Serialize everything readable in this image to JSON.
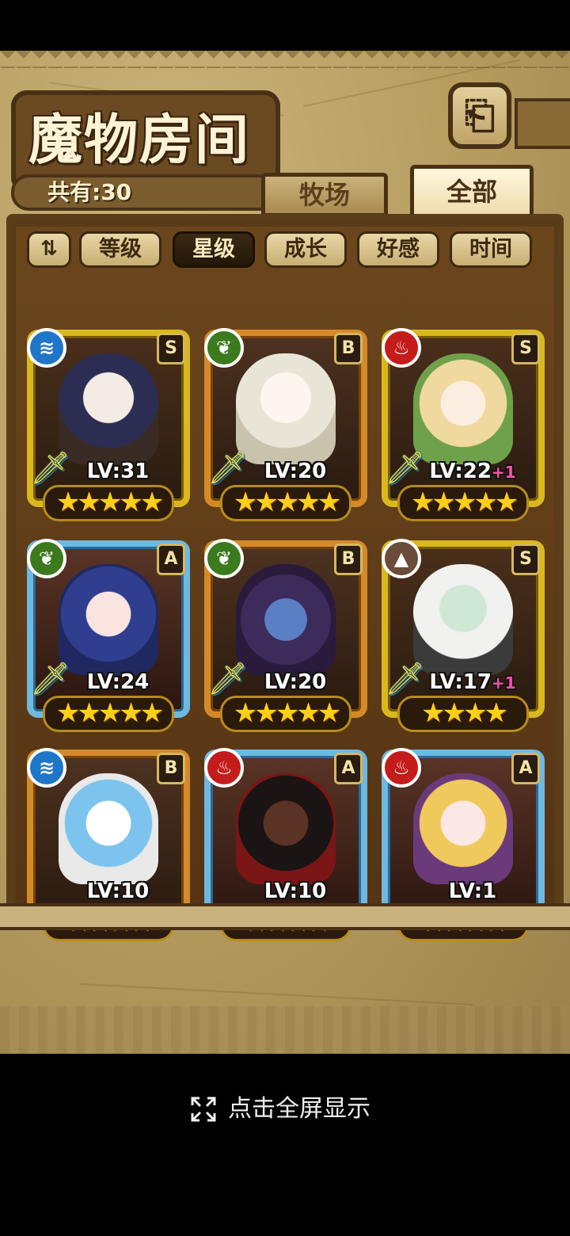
{
  "header": {
    "title": "魔物房间",
    "back_icon": "⎗"
  },
  "summary": {
    "count_label": "共有:30"
  },
  "tabs": [
    {
      "label": "牧场",
      "active": false
    },
    {
      "label": "全部",
      "active": true
    }
  ],
  "sort_toggle": {
    "label": "⇅"
  },
  "filters": [
    {
      "label": "等级",
      "active": false
    },
    {
      "label": "星级",
      "active": true
    },
    {
      "label": "成长",
      "active": false
    },
    {
      "label": "好感",
      "active": false
    },
    {
      "label": "时间",
      "active": false
    }
  ],
  "monsters": [
    {
      "element": "water",
      "element_icon": "≋",
      "rank": "S",
      "level": "LV:31",
      "plus": "",
      "stars": "★★★★★",
      "frame": "gold"
    },
    {
      "element": "grass",
      "element_icon": "❦",
      "rank": "B",
      "level": "LV:20",
      "plus": "",
      "stars": "★★★★★",
      "frame": "bronze"
    },
    {
      "element": "fire",
      "element_icon": "♨",
      "rank": "S",
      "level": "LV:22",
      "plus": "+1",
      "stars": "★★★★★",
      "frame": "gold"
    },
    {
      "element": "grass",
      "element_icon": "❦",
      "rank": "A",
      "level": "LV:24",
      "plus": "",
      "stars": "★★★★★",
      "frame": "blue"
    },
    {
      "element": "grass",
      "element_icon": "❦",
      "rank": "B",
      "level": "LV:20",
      "plus": "",
      "stars": "★★★★★",
      "frame": "bronze"
    },
    {
      "element": "earth",
      "element_icon": "▲",
      "rank": "S",
      "level": "LV:17",
      "plus": "+1",
      "stars": "★★★★",
      "frame": "gold"
    },
    {
      "element": "water",
      "element_icon": "≋",
      "rank": "B",
      "level": "LV:10",
      "plus": "",
      "stars": "★★★★",
      "frame": "bronze"
    },
    {
      "element": "fire",
      "element_icon": "♨",
      "rank": "A",
      "level": "LV:10",
      "plus": "",
      "stars": "★★★★",
      "frame": "blue"
    },
    {
      "element": "fire",
      "element_icon": "♨",
      "rank": "A",
      "level": "LV:1",
      "plus": "",
      "stars": "★★★★",
      "frame": "blue"
    }
  ],
  "footer": {
    "fullscreen_label": "点击全屏显示"
  }
}
